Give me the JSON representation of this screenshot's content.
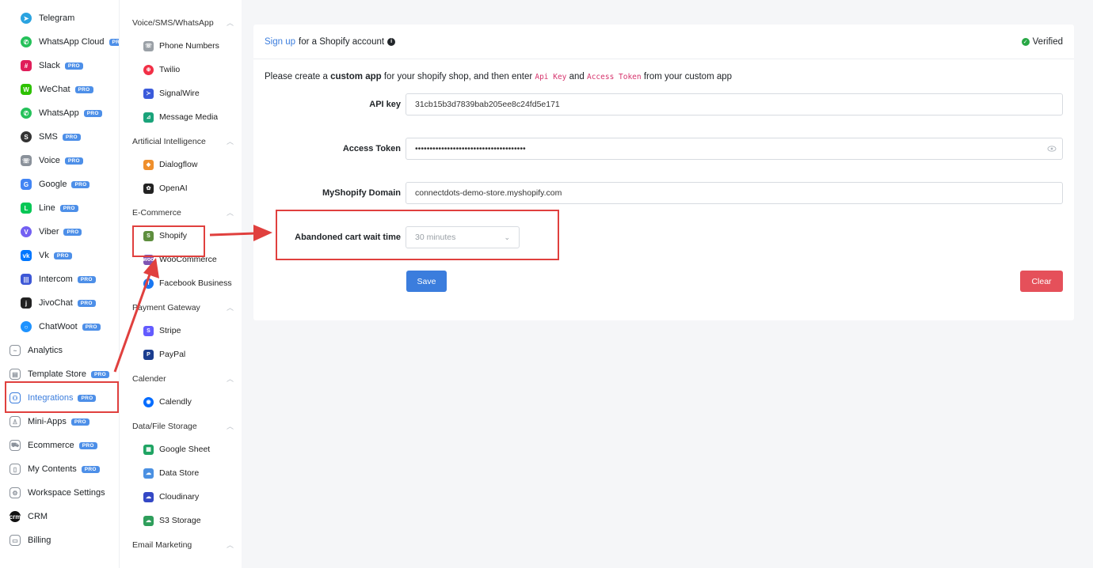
{
  "sidebar": {
    "pro_label": "PRO",
    "items": [
      {
        "label": "Telegram",
        "pro": false,
        "color": "#2aa3e0",
        "glyph": "➤",
        "icon": "telegram-icon"
      },
      {
        "label": "WhatsApp Cloud",
        "pro": true,
        "color": "#25c15a",
        "glyph": "✆",
        "icon": "whatsapp-icon"
      },
      {
        "label": "Slack",
        "pro": true,
        "color": "#e01e5a",
        "glyph": "#",
        "icon": "slack-icon"
      },
      {
        "label": "WeChat",
        "pro": true,
        "color": "#2dc100",
        "glyph": "W",
        "icon": "wechat-icon"
      },
      {
        "label": "WhatsApp",
        "pro": true,
        "color": "#25c15a",
        "glyph": "✆",
        "icon": "whatsapp-icon"
      },
      {
        "label": "SMS",
        "pro": true,
        "color": "#333333",
        "glyph": "S",
        "icon": "sms-icon"
      },
      {
        "label": "Voice",
        "pro": true,
        "color": "#8a919a",
        "glyph": "☏",
        "icon": "voice-icon"
      },
      {
        "label": "Google",
        "pro": true,
        "color": "#4285f4",
        "glyph": "G",
        "icon": "google-icon"
      },
      {
        "label": "Line",
        "pro": true,
        "color": "#06c755",
        "glyph": "L",
        "icon": "line-icon"
      },
      {
        "label": "Viber",
        "pro": true,
        "color": "#7360f2",
        "glyph": "V",
        "icon": "viber-icon"
      },
      {
        "label": "Vk",
        "pro": true,
        "color": "#0077ff",
        "glyph": "vk",
        "icon": "vk-icon"
      },
      {
        "label": "Intercom",
        "pro": true,
        "color": "#3d57d6",
        "glyph": "|||",
        "icon": "intercom-icon"
      },
      {
        "label": "JivoChat",
        "pro": true,
        "color": "#222222",
        "glyph": "j",
        "icon": "jivochat-icon"
      },
      {
        "label": "ChatWoot",
        "pro": true,
        "color": "#1f93ff",
        "glyph": "○",
        "icon": "chatwoot-icon"
      },
      {
        "label": "Analytics",
        "pro": false,
        "color": "#8a919a",
        "glyph": "~",
        "icon": "analytics-icon",
        "main": true
      },
      {
        "label": "Template Store",
        "pro": true,
        "color": "#8a919a",
        "glyph": "▤",
        "icon": "template-store-icon",
        "main": true
      },
      {
        "label": "Integrations",
        "pro": true,
        "color": "#3b7ddd",
        "glyph": "⚇",
        "icon": "integrations-icon",
        "main": true,
        "active": true
      },
      {
        "label": "Mini-Apps",
        "pro": true,
        "color": "#8a919a",
        "glyph": "♙",
        "icon": "mini-apps-icon",
        "main": true
      },
      {
        "label": "Ecommerce",
        "pro": true,
        "color": "#8a919a",
        "glyph": "⛟",
        "icon": "ecommerce-icon",
        "main": true
      },
      {
        "label": "My Contents",
        "pro": true,
        "color": "#8a919a",
        "glyph": "▯",
        "icon": "my-contents-icon",
        "main": true
      },
      {
        "label": "Workspace Settings",
        "pro": false,
        "color": "#8a919a",
        "glyph": "⚙",
        "icon": "workspace-settings-icon",
        "main": true
      },
      {
        "label": "CRM",
        "pro": false,
        "color": "#111111",
        "glyph": "crm",
        "icon": "crm-icon",
        "main": true,
        "solid": true
      },
      {
        "label": "Billing",
        "pro": false,
        "color": "#8a919a",
        "glyph": "▭",
        "icon": "billing-icon",
        "main": true
      }
    ]
  },
  "subnav": {
    "groups": [
      {
        "label": "Voice/SMS/WhatsApp",
        "items": [
          {
            "label": "Phone Numbers",
            "color": "#9aa0a6",
            "glyph": "☏",
            "icon": "phone-numbers-icon"
          },
          {
            "label": "Twilio",
            "color": "#f22f46",
            "glyph": "⊕",
            "icon": "twilio-icon"
          },
          {
            "label": "SignalWire",
            "color": "#3b5bdb",
            "glyph": "≻",
            "icon": "signalwire-icon"
          },
          {
            "label": "Message Media",
            "color": "#1aa37a",
            "glyph": "⊿",
            "icon": "message-media-icon"
          }
        ]
      },
      {
        "label": "Artificial Intelligence",
        "items": [
          {
            "label": "Dialogflow",
            "color": "#ef8f2c",
            "glyph": "◆",
            "icon": "dialogflow-icon"
          },
          {
            "label": "OpenAI",
            "color": "#222222",
            "glyph": "✿",
            "icon": "openai-icon"
          }
        ]
      },
      {
        "label": "E-Commerce",
        "items": [
          {
            "label": "Shopify",
            "color": "#5e8e3e",
            "glyph": "S",
            "icon": "shopify-icon",
            "active": true
          },
          {
            "label": "WooCommerce",
            "color": "#7f54b3",
            "glyph": "woo",
            "icon": "woocommerce-icon"
          },
          {
            "label": "Facebook Business",
            "color": "#1877f2",
            "glyph": "f",
            "icon": "facebook-business-icon"
          }
        ]
      },
      {
        "label": "Payment Gateway",
        "items": [
          {
            "label": "Stripe",
            "color": "#635bff",
            "glyph": "S",
            "icon": "stripe-icon"
          },
          {
            "label": "PayPal",
            "color": "#1a3d8f",
            "glyph": "P",
            "icon": "paypal-icon"
          }
        ]
      },
      {
        "label": "Calender",
        "items": [
          {
            "label": "Calendly",
            "color": "#006bff",
            "glyph": "◉",
            "icon": "calendly-icon"
          }
        ]
      },
      {
        "label": "Data/File Storage",
        "items": [
          {
            "label": "Google Sheet",
            "color": "#1fa463",
            "glyph": "▦",
            "icon": "google-sheet-icon"
          },
          {
            "label": "Data Store",
            "color": "#4a90e2",
            "glyph": "☁",
            "icon": "data-store-icon"
          },
          {
            "label": "Cloudinary",
            "color": "#3448c5",
            "glyph": "☁",
            "icon": "cloudinary-icon"
          },
          {
            "label": "S3 Storage",
            "color": "#2e9e5b",
            "glyph": "☁",
            "icon": "s3-storage-icon"
          }
        ]
      },
      {
        "label": "Email Marketing",
        "items": []
      }
    ]
  },
  "card": {
    "signup_link": "Sign up",
    "signup_rest": "for a Shopify account",
    "verified": "Verified",
    "instr": {
      "part1": "Please create a ",
      "bold": "custom app",
      "part2": " for your shopify shop, and then enter ",
      "code1": "Api Key",
      "and": " and ",
      "code2": "Access Token",
      "part3": " from your custom app"
    },
    "fields": {
      "api_key_label": "API key",
      "api_key_value": "31cb15b3d7839bab205ee8c24fd5e171",
      "access_token_label": "Access Token",
      "access_token_value": "••••••••••••••••••••••••••••••••••••••",
      "domain_label": "MyShopify Domain",
      "domain_value": "connectdots-demo-store.myshopify.com",
      "wait_label": "Abandoned cart wait time",
      "wait_value": "30 minutes"
    },
    "save_label": "Save",
    "clear_label": "Clear"
  },
  "colors": {
    "accent": "#3b7ddd",
    "danger": "#e5505a",
    "highlight": "#e0403e",
    "verified": "#28a745"
  }
}
